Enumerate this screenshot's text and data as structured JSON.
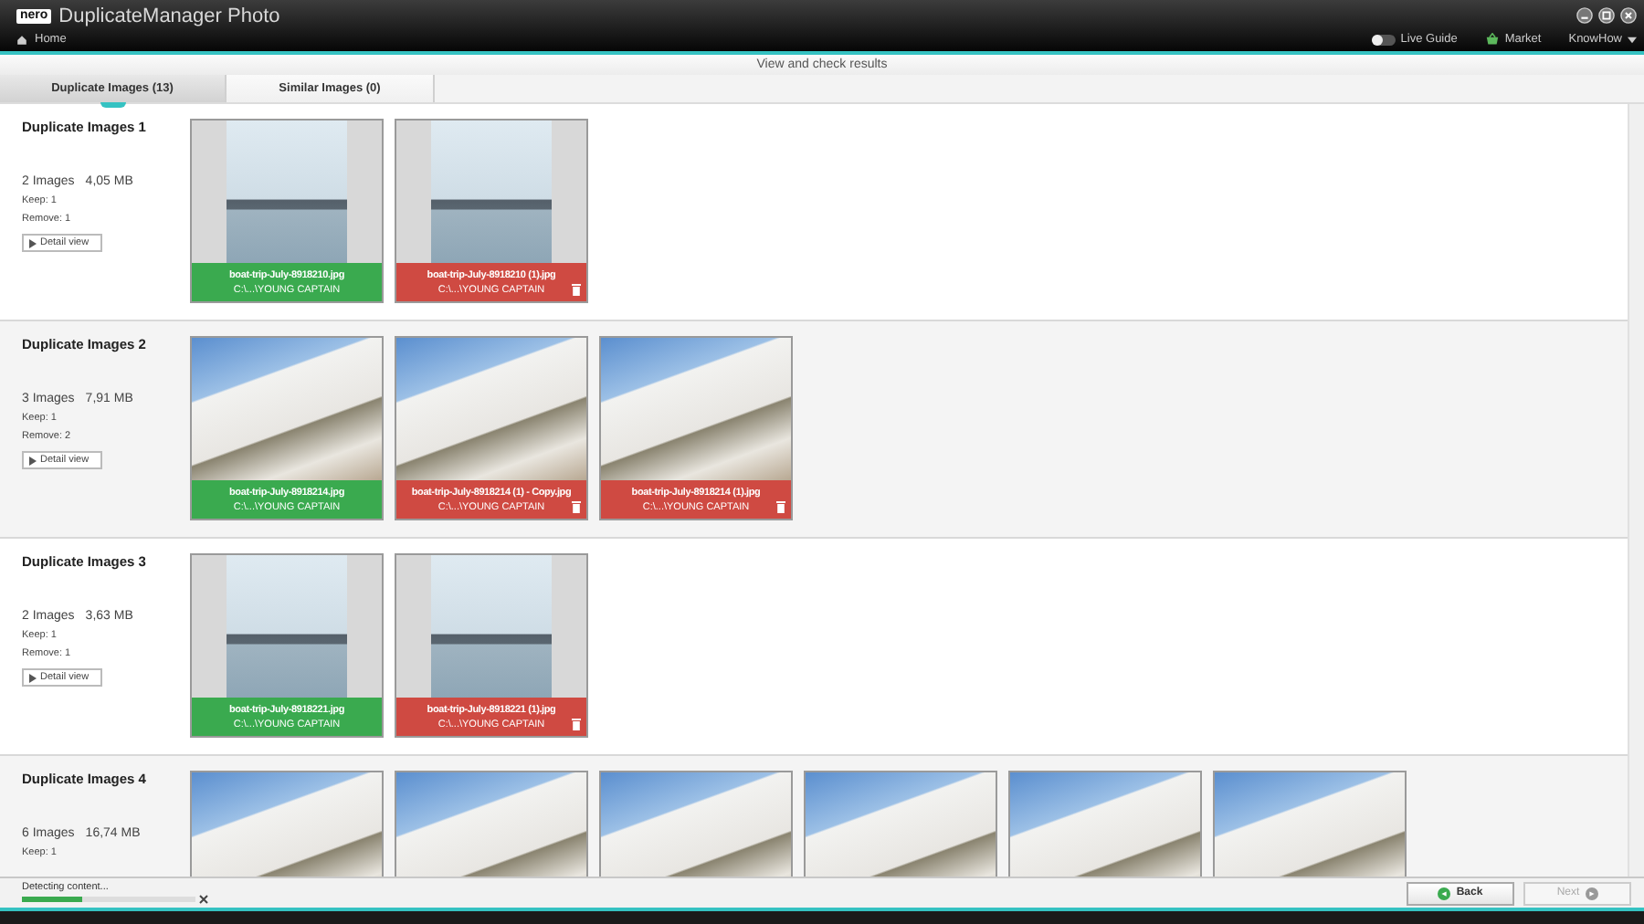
{
  "window": {
    "logo": "nero",
    "title": "DuplicateManager Photo"
  },
  "nav": {
    "home": "Home",
    "live_guide": {
      "label": "Live Guide",
      "on": false
    },
    "market": "Market",
    "knowhow": "KnowHow"
  },
  "header": "View and check results",
  "tabs": [
    {
      "label": "Duplicate Images (13)",
      "selected": true
    },
    {
      "label": "Similar Images (0)",
      "selected": false
    }
  ],
  "groups": [
    {
      "title": "Duplicate Images 1",
      "count": "2 Images",
      "size": "4,05 MB",
      "keep": "Keep: 1",
      "remove": "Remove: 1",
      "detail_button": "Detail view",
      "images": [
        {
          "kind": "portrait",
          "name": "boat-trip-July-8918210.jpg",
          "path": "C:\\...\\YOUNG CAPTAIN",
          "keep": true
        },
        {
          "kind": "portrait",
          "name": "boat-trip-July-8918210 (1).jpg",
          "path": "C:\\...\\YOUNG CAPTAIN",
          "keep": false
        }
      ]
    },
    {
      "title": "Duplicate Images 2",
      "count": "3 Images",
      "size": "7,91 MB",
      "keep": "Keep: 1",
      "remove": "Remove: 2",
      "detail_button": "Detail view",
      "images": [
        {
          "kind": "landscape",
          "name": "boat-trip-July-8918214.jpg",
          "path": "C:\\...\\YOUNG CAPTAIN",
          "keep": true
        },
        {
          "kind": "landscape",
          "name": "boat-trip-July-8918214 (1) - Copy.jpg",
          "path": "C:\\...\\YOUNG CAPTAIN",
          "keep": false
        },
        {
          "kind": "landscape",
          "name": "boat-trip-July-8918214 (1).jpg",
          "path": "C:\\...\\YOUNG CAPTAIN",
          "keep": false
        }
      ]
    },
    {
      "title": "Duplicate Images 3",
      "count": "2 Images",
      "size": "3,63 MB",
      "keep": "Keep: 1",
      "remove": "Remove: 1",
      "detail_button": "Detail view",
      "images": [
        {
          "kind": "portrait",
          "name": "boat-trip-July-8918221.jpg",
          "path": "C:\\...\\YOUNG CAPTAIN",
          "keep": true
        },
        {
          "kind": "portrait",
          "name": "boat-trip-July-8918221 (1).jpg",
          "path": "C:\\...\\YOUNG CAPTAIN",
          "keep": false
        }
      ]
    },
    {
      "title": "Duplicate Images 4",
      "count": "6 Images",
      "size": "16,74 MB",
      "keep": "Keep: 1",
      "images": [
        {
          "kind": "landscape"
        },
        {
          "kind": "landscape"
        },
        {
          "kind": "landscape"
        },
        {
          "kind": "landscape"
        },
        {
          "kind": "landscape"
        },
        {
          "kind": "landscape"
        }
      ]
    }
  ],
  "status": {
    "text": "Detecting content...",
    "level": 0.35
  },
  "buttons": [
    {
      "label": "Back",
      "disabled": false
    },
    {
      "label": "Next",
      "disabled": true
    }
  ]
}
